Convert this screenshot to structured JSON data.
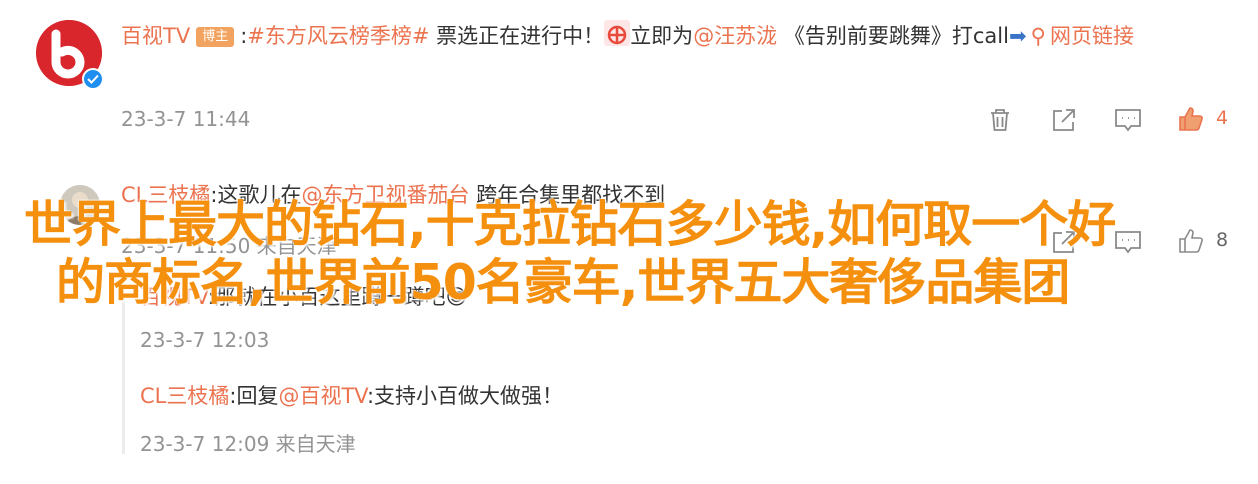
{
  "comment1": {
    "username": "百视TV",
    "badge": "博主",
    "text_before_hashtag": ":",
    "hashtag": "#东方风云榜季榜#",
    "text_middle": " 票选正在进行中！",
    "text_hot_after": "立即为",
    "mention": "@汪苏泷",
    "text_after_mention": " 《告别前要跳舞》打call",
    "emoji_arrow": "➡",
    "link_text": "网页链接",
    "link_line2": "链接",
    "timestamp": "23-3-7 11:44",
    "like_count": "4"
  },
  "comment2": {
    "username": "CL三枝橘",
    "text_prefix": ":这歌儿在",
    "mention": "@东方卫视番茄台",
    "text_after": " 跨年合集里都找不到",
    "timestamp": "23-3-7 11:50 来自天津",
    "like_count": "8"
  },
  "reply1": {
    "username": "百视TV",
    "text": ":那就在小百这里蹲一蹲吧",
    "emoji": "😎",
    "timestamp": "23-3-7 12:03"
  },
  "reply2": {
    "username": "CL三枝橘",
    "text_prefix": ":回复",
    "mention": "@百视TV",
    "text_after": ":支持小百做大做强！",
    "timestamp": "23-3-7 12:09 来自天津"
  },
  "overlay": {
    "line1": "世界上最大的钻石,十克拉钻石多少钱,如何取一个好",
    "line2": "的商标名,世界前50名豪车,世界五大奢侈品集团"
  },
  "colors": {
    "username": "#eb7350",
    "meta": "#939393",
    "overlay": "#f5900f",
    "badge": "#f1a35f",
    "avatar": "#d9262c"
  },
  "icons": [
    "verified-icon",
    "delete-icon",
    "share-icon",
    "comment-icon",
    "like-icon",
    "hot-icon",
    "link-icon"
  ]
}
